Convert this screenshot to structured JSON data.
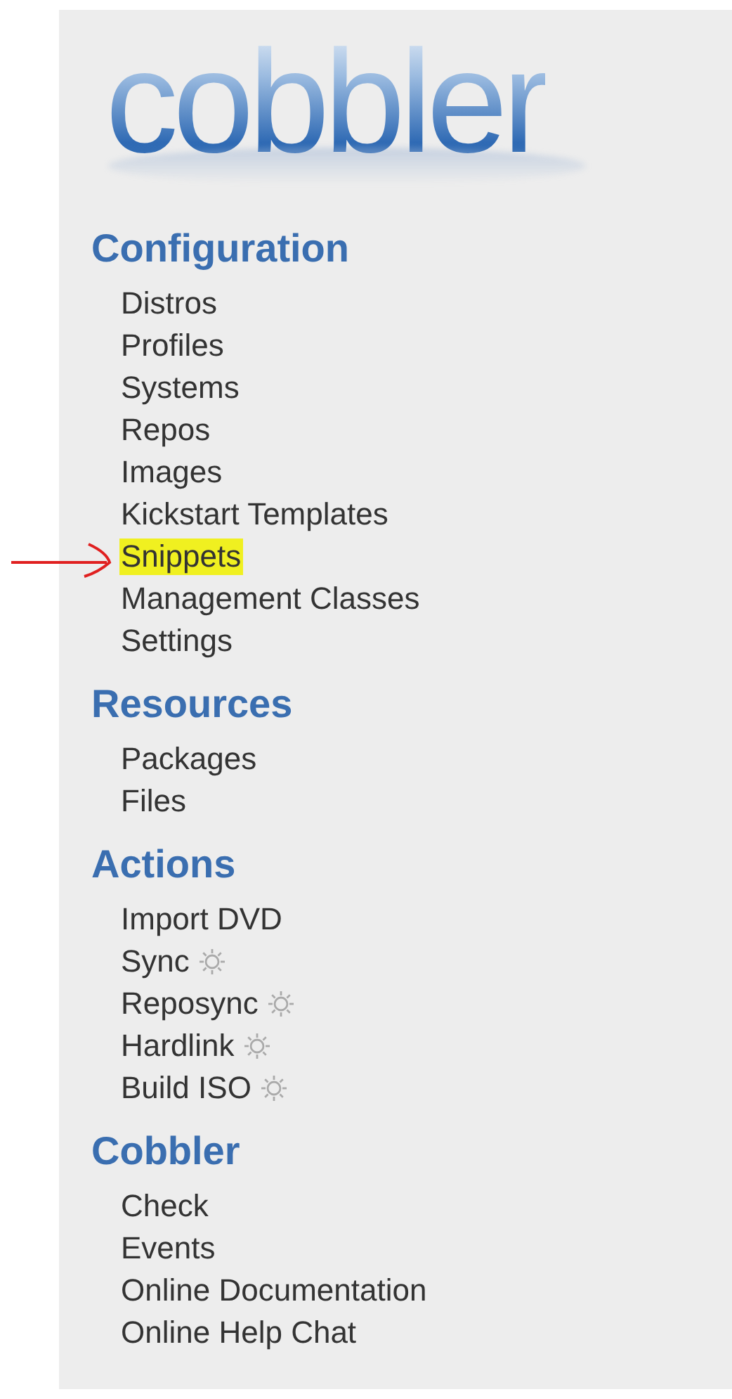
{
  "logo": {
    "text": "cobbler"
  },
  "sections": [
    {
      "title": "Configuration",
      "items": [
        {
          "label": "Distros",
          "gear": false,
          "highlighted": false
        },
        {
          "label": "Profiles",
          "gear": false,
          "highlighted": false
        },
        {
          "label": "Systems",
          "gear": false,
          "highlighted": false
        },
        {
          "label": "Repos",
          "gear": false,
          "highlighted": false
        },
        {
          "label": "Images",
          "gear": false,
          "highlighted": false
        },
        {
          "label": "Kickstart Templates",
          "gear": false,
          "highlighted": false
        },
        {
          "label": "Snippets",
          "gear": false,
          "highlighted": true
        },
        {
          "label": "Management Classes",
          "gear": false,
          "highlighted": false
        },
        {
          "label": "Settings",
          "gear": false,
          "highlighted": false
        }
      ]
    },
    {
      "title": "Resources",
      "items": [
        {
          "label": "Packages",
          "gear": false,
          "highlighted": false
        },
        {
          "label": "Files",
          "gear": false,
          "highlighted": false
        }
      ]
    },
    {
      "title": "Actions",
      "items": [
        {
          "label": "Import DVD",
          "gear": false,
          "highlighted": false
        },
        {
          "label": "Sync",
          "gear": true,
          "highlighted": false
        },
        {
          "label": "Reposync",
          "gear": true,
          "highlighted": false
        },
        {
          "label": "Hardlink",
          "gear": true,
          "highlighted": false
        },
        {
          "label": "Build ISO",
          "gear": true,
          "highlighted": false
        }
      ]
    },
    {
      "title": "Cobbler",
      "items": [
        {
          "label": "Check",
          "gear": false,
          "highlighted": false
        },
        {
          "label": "Events",
          "gear": false,
          "highlighted": false
        },
        {
          "label": "Online Documentation",
          "gear": false,
          "highlighted": false
        },
        {
          "label": "Online Help Chat",
          "gear": false,
          "highlighted": false
        }
      ]
    }
  ]
}
